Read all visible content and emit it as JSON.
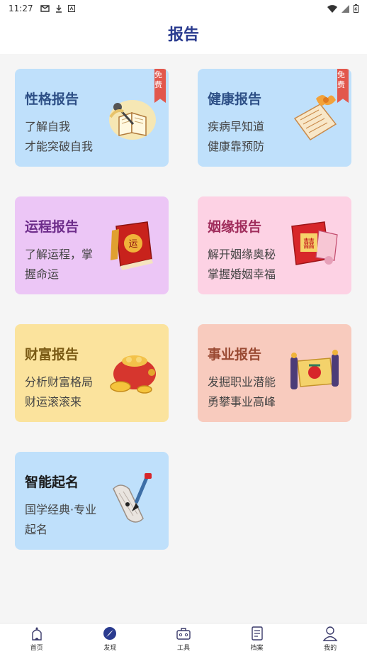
{
  "status_bar": {
    "time": "11:27"
  },
  "header": {
    "title": "报告"
  },
  "cards": [
    {
      "title": "性格报告",
      "line1": "了解自我",
      "line2": "才能突破自我",
      "badge": "免费",
      "icon": "book-quill-icon"
    },
    {
      "title": "健康报告",
      "line1": "疾病早知道",
      "line2": "健康靠预防",
      "badge": "免费",
      "icon": "scroll-icon"
    },
    {
      "title": "运程报告",
      "line1": "了解运程，掌",
      "line2": "握命运",
      "icon": "fortune-book-icon"
    },
    {
      "title": "姻缘报告",
      "line1": "解开姻缘奥秘",
      "line2": "掌握婚姻幸福",
      "icon": "double-happiness-icon"
    },
    {
      "title": "财富报告",
      "line1": "分析财富格局",
      "line2": "财运滚滚来",
      "icon": "treasure-bag-icon"
    },
    {
      "title": "事业报告",
      "line1": "发掘职业潜能",
      "line2": "勇攀事业高峰",
      "icon": "imperial-scroll-icon"
    },
    {
      "title": "智能起名",
      "line1": "国学经典·专业",
      "line2": "起名",
      "icon": "brush-scroll-icon"
    }
  ],
  "nav": [
    {
      "label": "首页",
      "icon": "home-icon"
    },
    {
      "label": "发现",
      "icon": "compass-icon"
    },
    {
      "label": "工具",
      "icon": "toolbox-icon"
    },
    {
      "label": "档案",
      "icon": "archive-icon"
    },
    {
      "label": "我的",
      "icon": "profile-icon"
    }
  ]
}
